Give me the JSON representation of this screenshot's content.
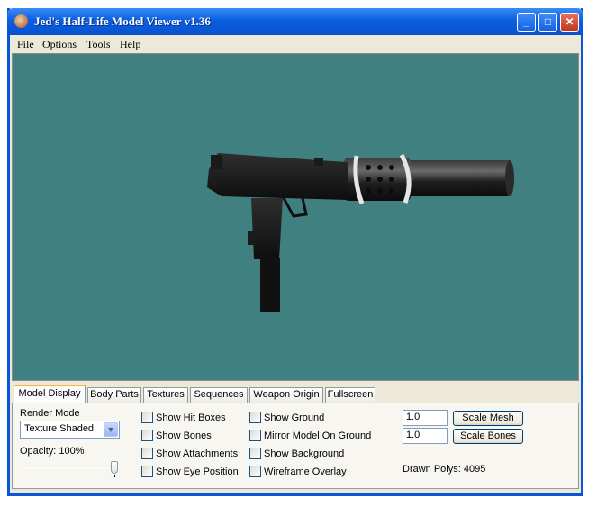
{
  "window": {
    "title": "Jed's Half-Life Model Viewer v1.36",
    "controls": {
      "minimize": "_",
      "maximize": "□",
      "close": "✕"
    }
  },
  "menu": [
    "File",
    "Options",
    "Tools",
    "Help"
  ],
  "tabs": [
    {
      "label": "Model Display",
      "active": true
    },
    {
      "label": "Body Parts"
    },
    {
      "label": "Textures"
    },
    {
      "label": "Sequences"
    },
    {
      "label": "Weapon Origin"
    },
    {
      "label": "Fullscreen"
    }
  ],
  "display": {
    "render_mode_label": "Render Mode",
    "render_mode_value": "Texture Shaded",
    "opacity_label": "Opacity: 100%",
    "opacity_fraction": 1.0,
    "checkboxes_col1": [
      "Show Hit Boxes",
      "Show Bones",
      "Show Attachments",
      "Show Eye Position"
    ],
    "checkboxes_col2": [
      "Show Ground",
      "Mirror Model On Ground",
      "Show Background",
      "Wireframe Overlay"
    ],
    "scale_mesh_value": "1.0",
    "scale_mesh_button": "Scale Mesh",
    "scale_bones_value": "1.0",
    "scale_bones_button": "Scale Bones",
    "drawn_polys": "Drawn Polys: 4095"
  },
  "colors": {
    "viewport_bg": "#418081",
    "titlebar": "#0a5fe0",
    "tab_highlight": "#f7b63b"
  }
}
